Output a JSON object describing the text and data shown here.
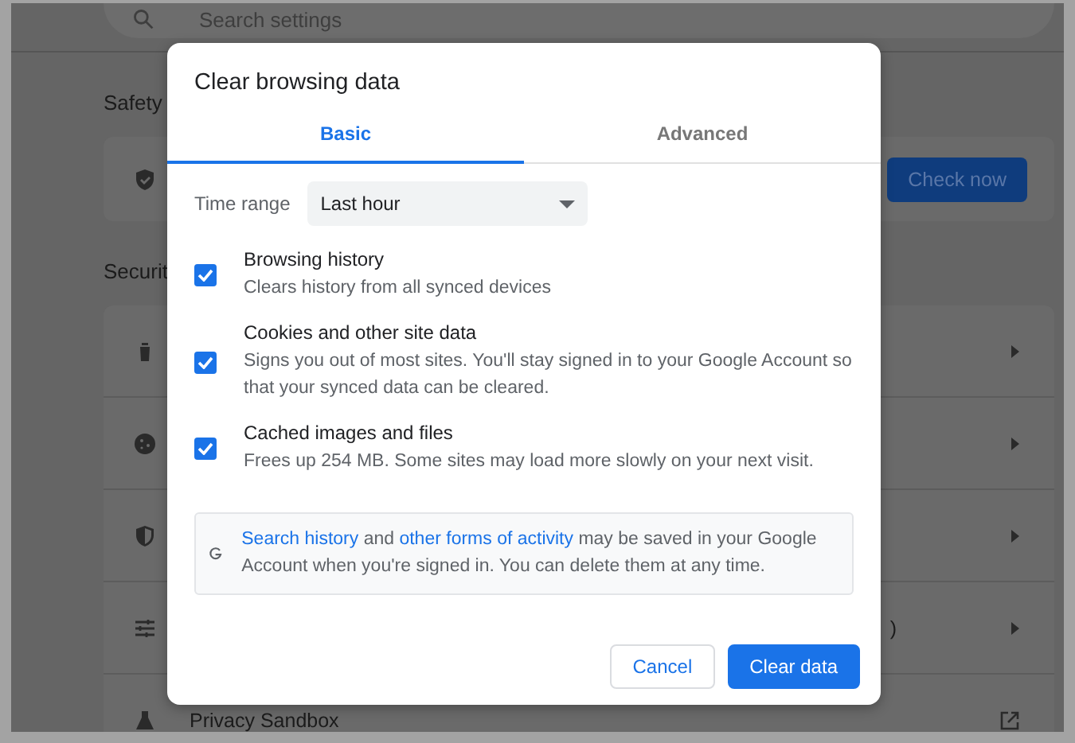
{
  "background": {
    "search": {
      "placeholder": "Search settings"
    },
    "safety": {
      "heading": "Safety",
      "button": "Check now"
    },
    "security": {
      "heading": "Securit",
      "rows": [
        {
          "kind": "arrow"
        },
        {
          "kind": "arrow"
        },
        {
          "kind": "arrow"
        },
        {
          "kind": "arrow",
          "text": ")"
        },
        {
          "kind": "external",
          "text": "Privacy Sandbox"
        }
      ]
    }
  },
  "dialog": {
    "title": "Clear browsing data",
    "tabs": [
      {
        "label": "Basic",
        "selected": true
      },
      {
        "label": "Advanced",
        "selected": false
      }
    ],
    "time_range": {
      "label": "Time range",
      "value": "Last hour"
    },
    "options": [
      {
        "title": "Browsing history",
        "description": "Clears history from all synced devices",
        "checked": true
      },
      {
        "title": "Cookies and other site data",
        "description": "Signs you out of most sites. You'll stay signed in to your Google Account so that your synced data can be cleared.",
        "checked": true
      },
      {
        "title": "Cached images and files",
        "description": "Frees up 254 MB. Some sites may load more slowly on your next visit.",
        "checked": true
      }
    ],
    "notice": {
      "link_1": "Search history",
      "text_1": " and ",
      "link_2": "other forms of activity",
      "text_2": " may be saved in your Google Account when you're signed in. You can delete them at any time."
    },
    "buttons": {
      "cancel": "Cancel",
      "confirm": "Clear data"
    }
  }
}
